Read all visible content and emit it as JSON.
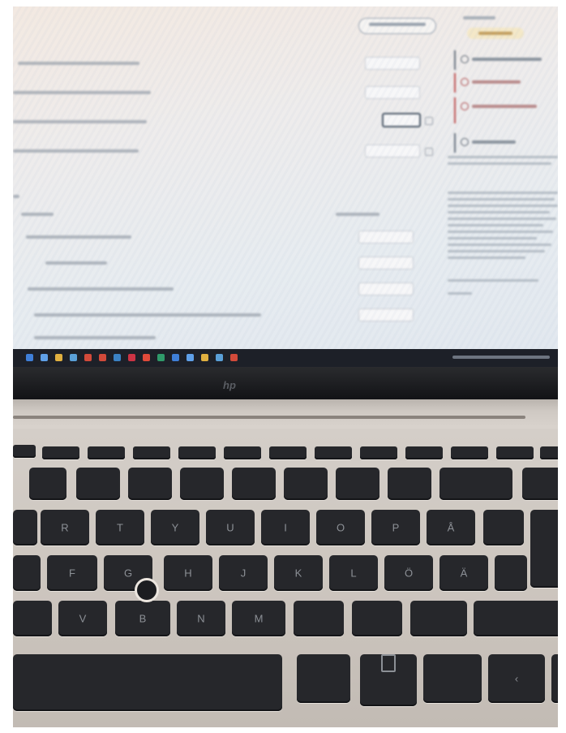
{
  "photo": {
    "subject": "laptop",
    "screen": {
      "taskbar_icon_colors": [
        "#3f7fd8",
        "#5fa0e8",
        "#e0b040",
        "#5aa0d8",
        "#d24a3a",
        "#d24a3a",
        "#3b82c4",
        "#cc3344",
        "#e04a3a",
        "#2f9a6a"
      ]
    },
    "brand_logo": "hp",
    "keyboard": {
      "keys": [
        [
          "R",
          "T",
          "Y",
          "U",
          "I",
          "O",
          "P",
          "Å"
        ],
        [
          "F",
          "G",
          "H",
          "J",
          "K",
          "L",
          "Ö",
          "Ä"
        ],
        [
          "V",
          "B",
          "N",
          "M"
        ]
      ]
    }
  }
}
